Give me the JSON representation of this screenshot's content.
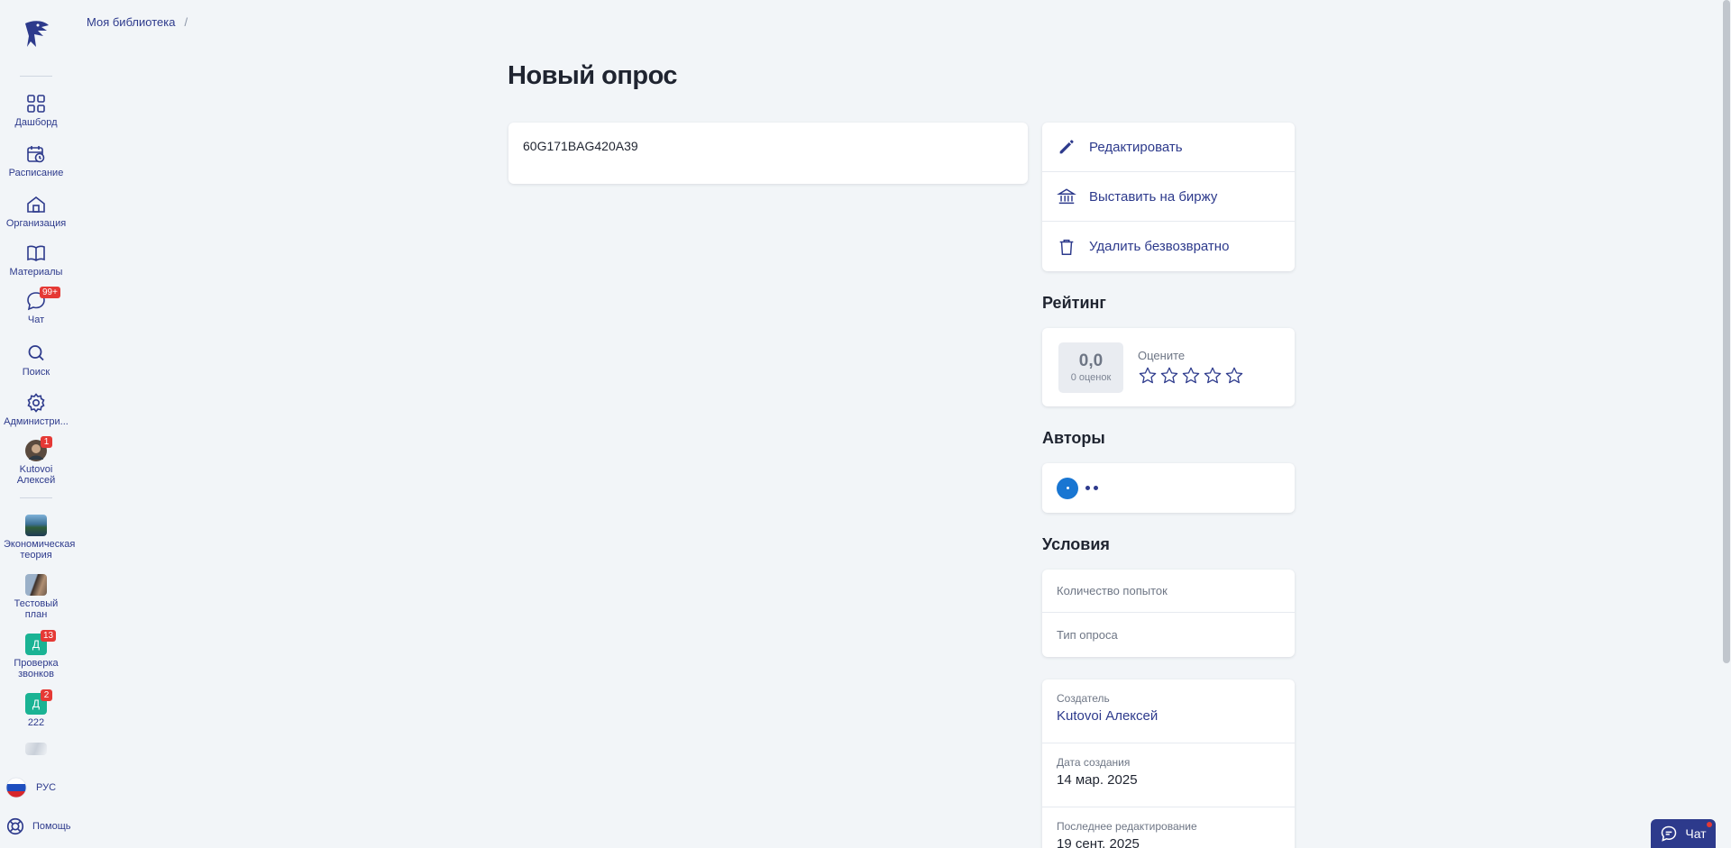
{
  "breadcrumb": {
    "library": "Моя библиотека",
    "separator": "/"
  },
  "page": {
    "title": "Новый опрос",
    "code": "60G171BAG420A39"
  },
  "sidebar": {
    "nav": [
      {
        "label": "Дашборд",
        "icon": "grid-icon"
      },
      {
        "label": "Расписание",
        "icon": "calendar-clock-icon"
      },
      {
        "label": "Организация",
        "icon": "building-icon"
      },
      {
        "label": "Материалы",
        "icon": "book-icon"
      },
      {
        "label": "Чат",
        "icon": "chat-icon",
        "badge": "99+"
      },
      {
        "label": "Поиск",
        "icon": "search-icon"
      },
      {
        "label": "Администри...",
        "icon": "gear-icon"
      }
    ],
    "user": {
      "label": "Kutovoi Алексей",
      "badge": "1"
    },
    "courses": [
      {
        "label": "Экономическая теория"
      },
      {
        "label": "Тестовый план"
      },
      {
        "label": "Проверка звонков",
        "badge": "13",
        "letter": "Д"
      },
      {
        "label": "222",
        "badge": "2",
        "letter": "Д"
      }
    ],
    "lang": "РУС",
    "help": "Помощь"
  },
  "actions": {
    "edit": "Редактировать",
    "exchange": "Выставить на биржу",
    "delete": "Удалить безвозвратно"
  },
  "rating": {
    "title": "Рейтинг",
    "value": "0,0",
    "count": "0 оценок",
    "rate_label": "Оцените",
    "stars": 0,
    "max_stars": 5
  },
  "authors": {
    "title": "Авторы"
  },
  "conditions": {
    "title": "Условия",
    "attempts_label": "Количество попыток",
    "type_label": "Тип опроса"
  },
  "meta": {
    "creator_label": "Создатель",
    "creator": "Kutovoi Алексей",
    "created_label": "Дата создания",
    "created": "14 мар. 2025",
    "edited_label": "Последнее редактирование",
    "edited": "19 сент. 2025"
  },
  "chat_button": "Чат",
  "colors": {
    "accent": "#2d3a8c",
    "badge": "#e53935",
    "author": "#1976d2"
  }
}
